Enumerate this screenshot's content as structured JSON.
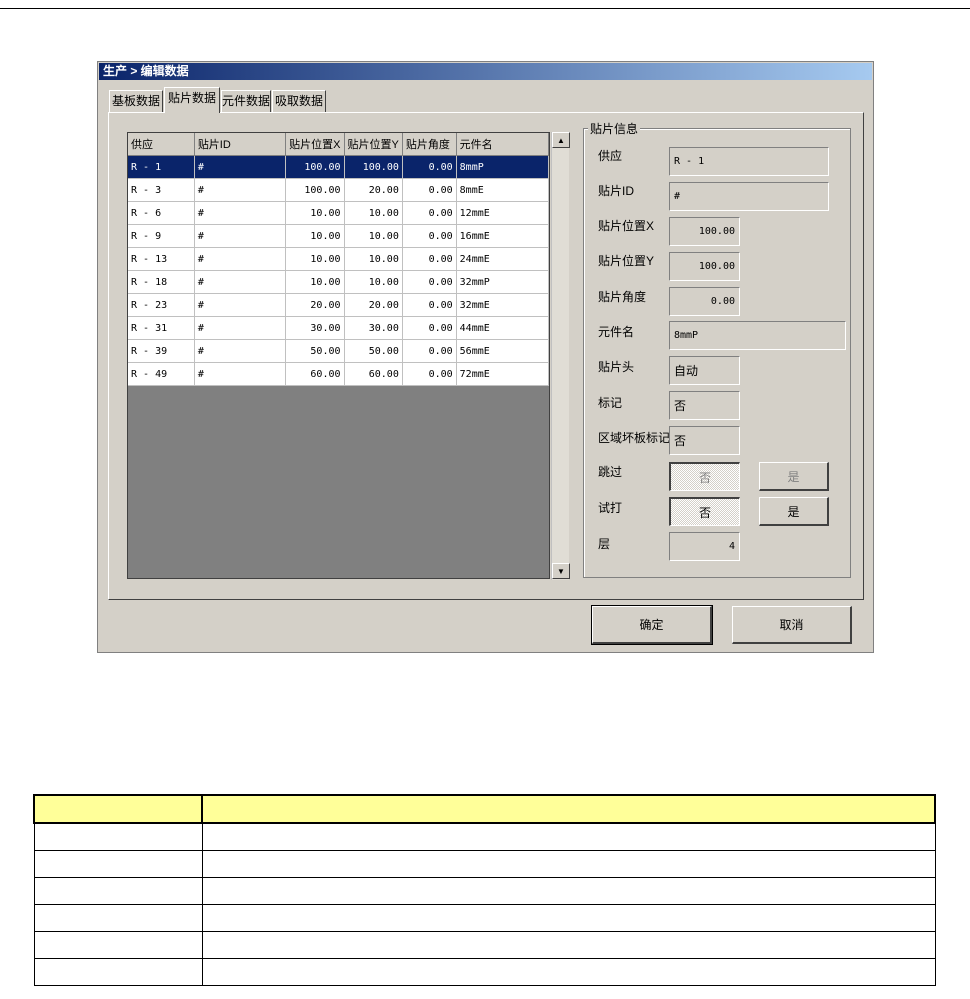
{
  "window": {
    "title": "生产 > 编辑数据"
  },
  "tabs": [
    {
      "label": "基板数据",
      "active": false
    },
    {
      "label": "贴片数据",
      "active": true
    },
    {
      "label": "元件数据",
      "active": false
    },
    {
      "label": "吸取数据",
      "active": false
    }
  ],
  "table": {
    "columns": [
      "供应",
      "贴片ID",
      "贴片位置X",
      "贴片位置Y",
      "贴片角度",
      "元件名"
    ],
    "rows": [
      [
        "R -  1",
        "#",
        "100.00",
        "100.00",
        "0.00",
        "8mmP"
      ],
      [
        "R -  3",
        "#",
        "100.00",
        "20.00",
        "0.00",
        "8mmE"
      ],
      [
        "R -  6",
        "#",
        "10.00",
        "10.00",
        "0.00",
        "12mmE"
      ],
      [
        "R -  9",
        "#",
        "10.00",
        "10.00",
        "0.00",
        "16mmE"
      ],
      [
        "R - 13",
        "#",
        "10.00",
        "10.00",
        "0.00",
        "24mmE"
      ],
      [
        "R - 18",
        "#",
        "10.00",
        "10.00",
        "0.00",
        "32mmP"
      ],
      [
        "R - 23",
        "#",
        "20.00",
        "20.00",
        "0.00",
        "32mmE"
      ],
      [
        "R - 31",
        "#",
        "30.00",
        "30.00",
        "0.00",
        "44mmE"
      ],
      [
        "R - 39",
        "#",
        "50.00",
        "50.00",
        "0.00",
        "56mmE"
      ],
      [
        "R - 49",
        "#",
        "60.00",
        "60.00",
        "0.00",
        "72mmE"
      ]
    ],
    "selected_row": 0
  },
  "scrollbar": {
    "up": "▲",
    "down": "▼"
  },
  "info": {
    "group_label": "贴片信息",
    "supply_label": "供应",
    "supply_value": "R -  1",
    "id_label": "贴片ID",
    "id_value": "#",
    "x_label": "贴片位置X",
    "x_value": "100.00",
    "y_label": "贴片位置Y",
    "y_value": "100.00",
    "angle_label": "贴片角度",
    "angle_value": "0.00",
    "part_label": "元件名",
    "part_value": "8mmP",
    "head_label": "贴片头",
    "head_value": "自动",
    "mark_label": "标记",
    "mark_value": "否",
    "badmark_label": "区域坏板标记",
    "badmark_value": "否",
    "skip_label": "跳过",
    "skip_no": "否",
    "skip_yes": "是",
    "trial_label": "试打",
    "trial_no": "否",
    "trial_yes": "是",
    "layer_label": "层",
    "layer_value": "4"
  },
  "buttons": {
    "ok": "确定",
    "cancel": "取消"
  },
  "legend_rows": 7
}
